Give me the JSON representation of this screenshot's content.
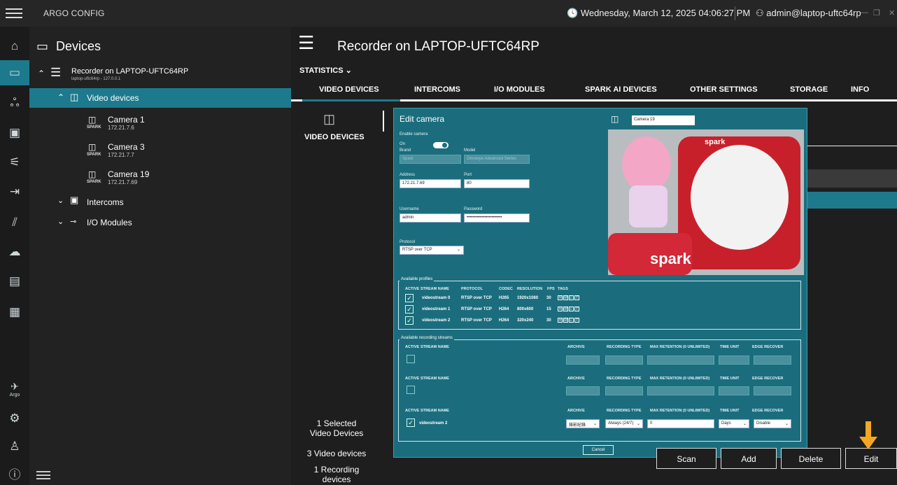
{
  "app": {
    "title": "ARGO CONFIG"
  },
  "header": {
    "datetime": "Wednesday, March 12, 2025 04:06:27 PM",
    "user": "admin@laptop-uftc64rp"
  },
  "sidebar_rail": {
    "icons": [
      "home-icon",
      "devices-icon",
      "users-icon",
      "monitor-icon",
      "plug-icon",
      "exit-icon",
      "analytics-icon",
      "cloud-icon",
      "report-icon",
      "log-icon",
      "argo-icon",
      "settings-icon",
      "person-icon",
      "info-icon"
    ],
    "argo_label": "Argo"
  },
  "tree": {
    "title": "Devices",
    "recorder": {
      "name": "Recorder on LAPTOP-UFTC64RP",
      "host": "laptop-uftc64rp - 127.0.0.1"
    },
    "video_group": "Video devices",
    "cameras": [
      {
        "name": "Camera 1",
        "ip": "172.21.7.6",
        "brand": "SPARK"
      },
      {
        "name": "Camera 3",
        "ip": "172.21.7.7",
        "brand": "SPARK"
      },
      {
        "name": "Camera 19",
        "ip": "172.21.7.69",
        "brand": "SPARK"
      }
    ],
    "intercoms": "Intercoms",
    "io_modules": "I/O Modules"
  },
  "main": {
    "title": "Recorder on LAPTOP-UFTC64RP",
    "statistics": "STATISTICS",
    "tabs": [
      "VIDEO DEVICES",
      "INTERCOMS",
      "I/O MODULES",
      "SPARK AI DEVICES",
      "OTHER SETTINGS",
      "STORAGE",
      "INFO"
    ],
    "section_label": "VIDEO DEVICES",
    "summary": {
      "selected": "1 Selected",
      "selected2": "Video Devices",
      "count": "3 Video devices",
      "rec": "1 Recording",
      "rec2": "devices"
    }
  },
  "dialog": {
    "title": "Edit camera",
    "enable_label": "Enable camera",
    "enable_state": "On",
    "brand_label": "Brand",
    "brand_value": "Spark",
    "model_label": "Model",
    "model_value": "Omnieye Advanced Series",
    "address_label": "Address",
    "address_value": "172.21.7.69",
    "port_label": "Port",
    "port_value": "80",
    "username_label": "Username",
    "username_value": "admin",
    "password_label": "Password",
    "password_value": "••••••••••••••••••••••••",
    "protocol_label": "Protocol",
    "protocol_value": "RTSP over TCP",
    "camera_name": "Camera 19",
    "profiles_title": "Available profiles",
    "profile_headers": [
      "ACTIVE",
      "STREAM NAME",
      "PROTOCOL",
      "CODEC",
      "RESOLUTION",
      "FPS",
      "TAGS"
    ],
    "profiles": [
      {
        "name": "videostream 0",
        "protocol": "RTSP over TCP",
        "codec": "H265",
        "res": "1920x1080",
        "fps": "30"
      },
      {
        "name": "videostream 1",
        "protocol": "RTSP over TCP",
        "codec": "H264",
        "res": "800x600",
        "fps": "15"
      },
      {
        "name": "videostream 2",
        "protocol": "RTSP over TCP",
        "codec": "H264",
        "res": "320x240",
        "fps": "30"
      }
    ],
    "tags": [
      "H",
      "M",
      "L",
      "T"
    ],
    "rec_title": "Available recording streams",
    "rec_headers": [
      "ACTIVE",
      "STREAM NAME",
      "ARCHIVE",
      "RECORDING TYPE",
      "MAX RETENTION (0 UNLIMITED)",
      "TIME UNIT",
      "EDGE RECOVER"
    ],
    "rec_row": {
      "name": "videostream 2",
      "archive": "錄影紀錄",
      "type": "Always (24/7)",
      "retention": "0",
      "unit": "Days",
      "edge": "Disable"
    },
    "cancel": "Cancel",
    "preview_text": "spark"
  },
  "buttons": {
    "scan": "Scan",
    "add": "Add",
    "delete": "Delete",
    "edit": "Edit"
  },
  "colors": {
    "accent": "#1d7a8c",
    "dialog": "#1b6d7d",
    "arrow": "#f5a623"
  }
}
